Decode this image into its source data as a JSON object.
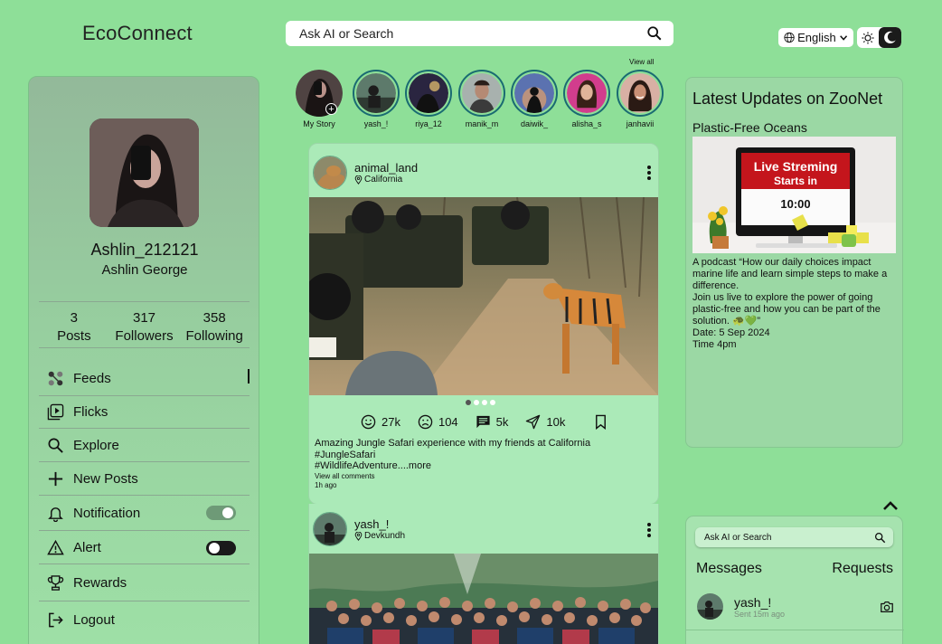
{
  "brand": "EcoConnect",
  "search": {
    "placeholder": "Ask AI or Search"
  },
  "language": {
    "selected": "English"
  },
  "profile": {
    "username": "Ashlin_212121",
    "full_name": "Ashlin George",
    "stats": [
      {
        "value": "3",
        "label": "Posts"
      },
      {
        "value": "317",
        "label": "Followers"
      },
      {
        "value": "358",
        "label": "Following"
      }
    ]
  },
  "menu": [
    {
      "label": "Feeds",
      "icon": "feeds-icon",
      "active": true
    },
    {
      "label": "Flicks",
      "icon": "flicks-icon"
    },
    {
      "label": "Explore",
      "icon": "search-icon"
    },
    {
      "label": "New Posts",
      "icon": "plus-icon"
    },
    {
      "label": "Notification",
      "icon": "bell-icon",
      "toggle": "on"
    },
    {
      "label": "Alert",
      "icon": "alert-icon",
      "toggle": "off"
    },
    {
      "label": "Rewards",
      "icon": "trophy-icon"
    },
    {
      "label": "Logout",
      "icon": "logout-icon"
    }
  ],
  "stories": {
    "view_all": "View all",
    "items": [
      {
        "name": "My Story",
        "mine": true
      },
      {
        "name": "yash_!"
      },
      {
        "name": "riya_12"
      },
      {
        "name": "manik_m"
      },
      {
        "name": "daiwik_"
      },
      {
        "name": "alisha_s"
      },
      {
        "name": "janhavii"
      }
    ]
  },
  "posts": [
    {
      "user": "animal_land",
      "location": "California",
      "likes": "27k",
      "dislikes": "104",
      "comments": "5k",
      "shares": "10k",
      "caption_lines": [
        "Amazing Jungle Safari experience with my friends at California",
        "#JungleSafari",
        "#WildlifeAdventure....more"
      ],
      "view_comments": "View all comments",
      "time": "1h ago"
    },
    {
      "user": "yash_!",
      "location": "Devkundh"
    }
  ],
  "updates": {
    "title": "Latest Updates on ZooNet",
    "subtitle": "Plastic-Free Oceans",
    "banner_line1": "Live Streming",
    "banner_line2": "Starts in",
    "banner_time": "10:00",
    "desc": [
      "A podcast “How our daily choices impact marine life and learn simple steps to make a difference.",
      "Join us live to explore the power of going plastic-free and how you can be part of the solution. 🐢💚”",
      "Date: 5 Sep 2024",
      "Time 4pm"
    ]
  },
  "messages": {
    "search_placeholder": "Ask AI or Search",
    "tab_messages": "Messages",
    "tab_requests": "Requests",
    "items": [
      {
        "name": "yash_!",
        "time": "Sent 15m ago"
      }
    ]
  },
  "colors": {
    "background": "#8edf98",
    "story_ring": "#1a6b72"
  }
}
